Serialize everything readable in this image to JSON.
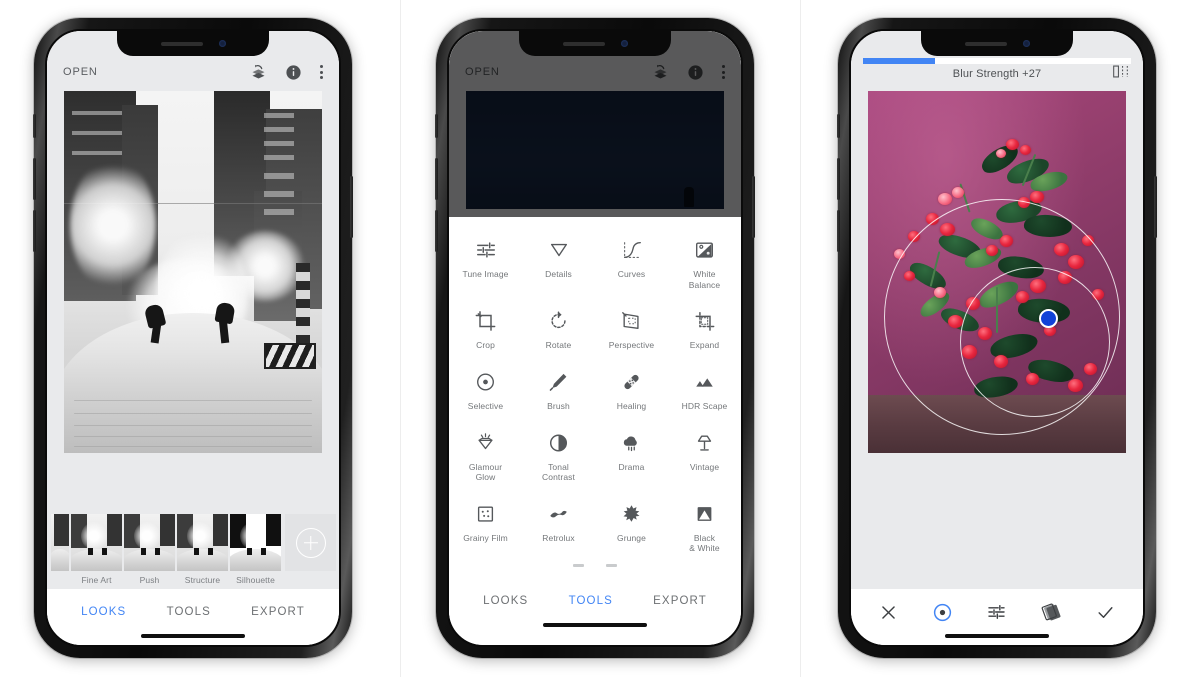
{
  "scene": {
    "background_color": "#ffffff",
    "accent_blue": "#4285F4",
    "phone_count": 3
  },
  "phone1": {
    "header": {
      "open_label": "OPEN",
      "icons": [
        {
          "name": "undo-stack-icon",
          "label": "Undo"
        },
        {
          "name": "info-icon",
          "label": "Info"
        },
        {
          "name": "overflow-menu-icon",
          "label": "More options"
        }
      ]
    },
    "photo": {
      "description": "Black and white winter city street with steam and two figures in snow"
    },
    "looks": [
      {
        "label": "Fine Art"
      },
      {
        "label": "Push"
      },
      {
        "label": "Structure"
      },
      {
        "label": "Silhouette"
      }
    ],
    "add_look": {
      "name": "add-look-button",
      "glyph": "+"
    },
    "tabs": [
      {
        "label": "LOOKS",
        "active": true
      },
      {
        "label": "TOOLS",
        "active": false
      },
      {
        "label": "EXPORT",
        "active": false
      }
    ]
  },
  "phone2": {
    "header": {
      "open_label": "OPEN",
      "icons": [
        {
          "name": "undo-stack-icon",
          "label": "Undo"
        },
        {
          "name": "info-icon",
          "label": "Info"
        },
        {
          "name": "overflow-menu-icon",
          "label": "More options"
        }
      ]
    },
    "tools": [
      {
        "label": "Tune Image",
        "icon": "sliders-icon"
      },
      {
        "label": "Details",
        "icon": "triangle-down-icon"
      },
      {
        "label": "Curves",
        "icon": "curve-icon"
      },
      {
        "label": "White\nBalance",
        "label_line1": "White",
        "label_line2": "Balance",
        "icon": "white-balance-icon"
      },
      {
        "label": "Crop",
        "icon": "crop-icon"
      },
      {
        "label": "Rotate",
        "icon": "rotate-icon"
      },
      {
        "label": "Perspective",
        "icon": "perspective-icon"
      },
      {
        "label": "Expand",
        "icon": "expand-icon"
      },
      {
        "label": "Selective",
        "icon": "selective-target-icon"
      },
      {
        "label": "Brush",
        "icon": "brush-icon"
      },
      {
        "label": "Healing",
        "icon": "healing-bandage-icon"
      },
      {
        "label": "HDR Scape",
        "icon": "hdr-mountain-icon"
      },
      {
        "label": "Glamour\nGlow",
        "label_line1": "Glamour",
        "label_line2": "Glow",
        "icon": "glamour-glow-icon"
      },
      {
        "label": "Tonal\nContrast",
        "label_line1": "Tonal",
        "label_line2": "Contrast",
        "icon": "tonal-contrast-icon"
      },
      {
        "label": "Drama",
        "icon": "drama-cloud-icon"
      },
      {
        "label": "Vintage",
        "icon": "vintage-lamp-icon"
      },
      {
        "label": "Grainy Film",
        "icon": "grainy-film-icon"
      },
      {
        "label": "Retrolux",
        "icon": "retrolux-icon"
      },
      {
        "label": "Grunge",
        "icon": "grunge-icon"
      },
      {
        "label": "Black\n& White",
        "label_line1": "Black",
        "label_line2": "& White",
        "icon": "black-white-icon"
      }
    ],
    "tabs": [
      {
        "label": "LOOKS",
        "active": false
      },
      {
        "label": "TOOLS",
        "active": true
      },
      {
        "label": "EXPORT",
        "active": false
      }
    ]
  },
  "phone3": {
    "slider": {
      "title": "Blur Strength +27",
      "value": 27,
      "fill_percent": 27,
      "fill_color": "#4285F4"
    },
    "compare_icon": {
      "name": "compare-split-icon"
    },
    "photo": {
      "description": "Red euphorbia crown-of-thorns flowers against purple wall with selective edit circles"
    },
    "selection": {
      "outer_circle": true,
      "inner_circle": true,
      "handle_color": "#1042d8"
    },
    "toolbar": [
      {
        "name": "cancel-button",
        "icon": "close-x-icon",
        "active": false
      },
      {
        "name": "selective-target-button",
        "icon": "target-circle-icon",
        "active": true
      },
      {
        "name": "adjust-sliders-button",
        "icon": "sliders-icon",
        "active": false
      },
      {
        "name": "stacks-button",
        "icon": "stack-layers-icon",
        "active": false
      },
      {
        "name": "apply-button",
        "icon": "checkmark-icon",
        "active": false
      }
    ]
  }
}
